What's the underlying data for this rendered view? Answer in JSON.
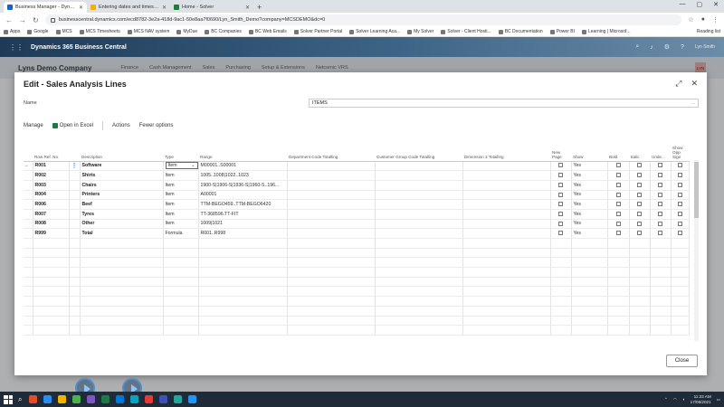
{
  "browser": {
    "tabs": [
      {
        "label": "Business Manager - Dynamics 36",
        "active": true
      },
      {
        "label": "Entering dates and times in Busi",
        "active": false
      },
      {
        "label": "Home - Solver",
        "active": false
      }
    ],
    "url": "businesscentral.dynamics.com/ecd8782-3e2a-418d-9ac1-50e8aa7f0690/Lyn_Smith_Demo?company=MCSDEMO&dc=0",
    "bookmarks": [
      "Apps",
      "Google",
      "MCS",
      "MCS Timesheets",
      "MCS NAV system",
      "MyDue",
      "BC Companies",
      "BC Web Emails",
      "Solver Partner Portal",
      "Solver Learning Aca...",
      "My Solver",
      "Solver - Client Hosti...",
      "BC Documentation",
      "Power BI",
      "Learning | Microsof..."
    ],
    "reading_list": "Reading list"
  },
  "bc": {
    "product": "Dynamics 365 Business Central",
    "user": "Lyn Smith",
    "company": "Lyns Demo Company",
    "menu": [
      "Finance",
      "Cash Management",
      "Sales",
      "Purchasing",
      "Setup & Extensions",
      "Netcomic VRS"
    ],
    "avatar": "LYN"
  },
  "dialog": {
    "title": "Edit - Sales Analysis Lines",
    "name_label": "Name",
    "name_value": "ITEMS",
    "name_dots": "...",
    "actions": {
      "manage": "Manage",
      "open_excel": "Open in Excel",
      "actions": "Actions",
      "fewer": "Fewer options"
    },
    "columns": [
      "Row Ref. No.",
      "Description",
      "Type",
      "Range",
      "Department Code Totalling",
      "Customer Group Code Totalling",
      "Dimension 3 Totalling",
      "New Page",
      "Show",
      "Bold",
      "Italic",
      "Unde...",
      "Show Opp. Sign"
    ],
    "rows": [
      {
        "ref": "R001",
        "desc": "Software",
        "type": "Item",
        "range": "M00001..S00001",
        "show": "Yes"
      },
      {
        "ref": "R002",
        "desc": "Shirts",
        "type": "Item",
        "range": "1005..1008|1022..1023",
        "show": "Yes"
      },
      {
        "ref": "R003",
        "desc": "Chairs",
        "type": "Item",
        "range": "1900-S|1906-S|1936-S|1960-S..196...",
        "show": "Yes"
      },
      {
        "ref": "R004",
        "desc": "Printers",
        "type": "Item",
        "range": "A00001",
        "show": "Yes"
      },
      {
        "ref": "R006",
        "desc": "Beef",
        "type": "Item",
        "range": "TTM-BEGO459..TTM-BEGO6420",
        "show": "Yes"
      },
      {
        "ref": "R007",
        "desc": "Tyres",
        "type": "Item",
        "range": "TT-368596.TT-FIT",
        "show": "Yes"
      },
      {
        "ref": "R008",
        "desc": "Other",
        "type": "Item",
        "range": "1009|1021",
        "show": "Yes"
      },
      {
        "ref": "R999",
        "desc": "Total",
        "type": "Formula",
        "range": "R001..R998",
        "show": "Yes"
      }
    ],
    "close_label": "Close"
  },
  "taskbar": {
    "time": "11:23 AM",
    "date": "17/06/2021",
    "app_colors": [
      "#e34c26",
      "#2d8cf0",
      "#f2b300",
      "#4caf50",
      "#7e57c2",
      "#1e7a44",
      "#0078d4",
      "#0aa2c0",
      "#e53935",
      "#3f51b5",
      "#26a69a",
      "#2196f3"
    ]
  }
}
